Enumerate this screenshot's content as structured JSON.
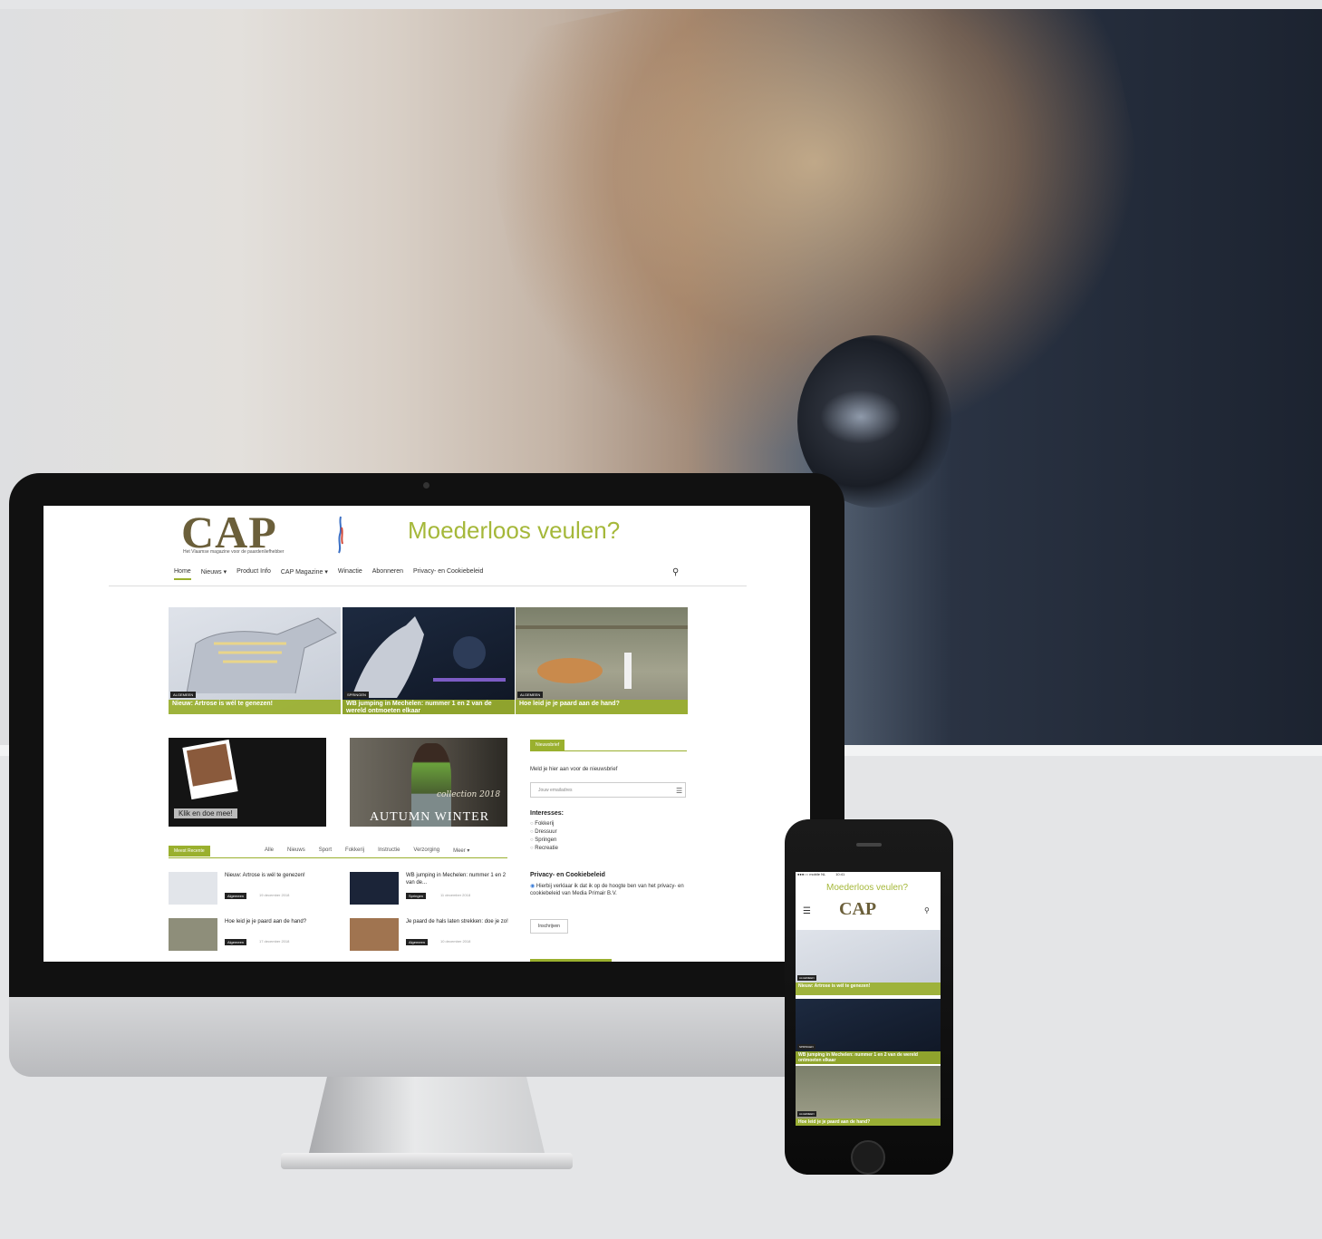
{
  "site": {
    "logo": "CAP",
    "tagline": "Het Vlaamse magazine voor de paardenliefhebber",
    "headline": "Moederloos veulen?"
  },
  "nav": {
    "items": [
      "Home",
      "Nieuws ▾",
      "Product Info",
      "CAP Magazine ▾",
      "Winactie",
      "Abonneren",
      "Privacy- en Cookiebeleid"
    ],
    "active_index": 0
  },
  "featured": [
    {
      "category": "ALGEMEEN",
      "title": "Nieuw: Artrose is wél te genezen!"
    },
    {
      "category": "SPRINGEN",
      "title": "WB jumping in Mechelen: nummer 1 en 2 van de wereld ontmoeten elkaar"
    },
    {
      "category": "ALGEMEEN",
      "title": "Hoe leid je je paard aan de hand?"
    }
  ],
  "banners": {
    "banner1_button": "Klik en doe mee!",
    "banner2_script": "collection 2018",
    "banner2_title": "AUTUMN WINTER"
  },
  "newsletter": {
    "tab": "Nieuwsbrief",
    "intro": "Meld je hier aan voor de nieuwsbrief",
    "email_placeholder": "Jouw emailadres",
    "interests_title": "Interesses:",
    "interests": [
      "Fokkerij",
      "Dressuur",
      "Springen",
      "Recreatie"
    ],
    "privacy_title": "Privacy- en Cookiebeleid",
    "privacy_text": "Hierbij verklaar ik dat ik op de hoogte ben van het privacy- en cookiebeleid van Media Primair B.V.",
    "submit_label": "Inschrijven"
  },
  "recent": {
    "tab": "Meest Recente",
    "filters": [
      "Alle",
      "Nieuws",
      "Sport",
      "Fokkerij",
      "Instructie",
      "Verzorging",
      "Meer ▾"
    ],
    "articles": [
      {
        "title": "Nieuw: Artrose is wél te genezen!",
        "tag": "Algemeen",
        "date": "19 december 2018"
      },
      {
        "title": "WB jumping in Mechelen: nummer 1 en 2 van de...",
        "tag": "Springen",
        "date": "11 december 2018"
      },
      {
        "title": "Hoe leid je je paard aan de hand?",
        "tag": "Algemeen",
        "date": "17 december 2018"
      },
      {
        "title": "Je paard de hals laten strekken: doe je zo!",
        "tag": "Algemeen",
        "date": "10 december 2018"
      }
    ]
  },
  "phone": {
    "status": "●●●○○ mobile NL",
    "time": "10:41",
    "headline": "Moederloos veulen?",
    "logo": "CAP",
    "tiles": [
      {
        "category": "ALGEMEEN",
        "title": "Nieuw: Artrose is wél te genezen!"
      },
      {
        "category": "SPRINGEN",
        "title": "WB jumping in Mechelen: nummer 1 en 2 van de wereld ontmoeten elkaar"
      },
      {
        "category": "ALGEMEEN",
        "title": "Hoe leid je je paard aan de hand?"
      }
    ]
  },
  "colors": {
    "accent": "#9ab02e",
    "logo": "#6b5f3a",
    "headline": "#a5b83a"
  },
  "icons": [
    "search-icon",
    "email-icon",
    "menu-icon",
    "rider-figure-icon"
  ]
}
